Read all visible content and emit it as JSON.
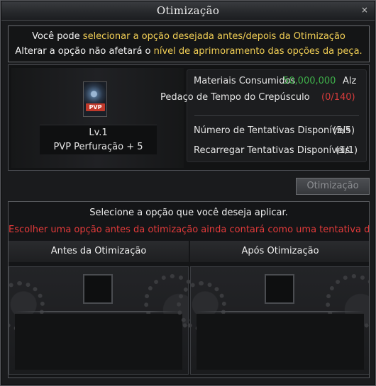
{
  "window": {
    "title": "Otimização",
    "close_label": "×"
  },
  "info": {
    "line1_a": "Você pode ",
    "line1_b": "selecionar a opção desejada antes/depois da Otimização",
    "line2_a": "Alterar a opção não afetará o ",
    "line2_b": "nível de aprimoramento das opções da peça."
  },
  "item": {
    "badge": "PVP",
    "level": "Lv.1",
    "name": "PVP Perfuração  + 5"
  },
  "stats": {
    "materials_label": "Materiais Consumidos",
    "materials_value": "50,000,000",
    "materials_unit": "Alz",
    "piece_label": "Pedaço de Tempo do Crepúsculo",
    "piece_value": "(0/140)",
    "attempts_label": "Número de Tentativas Disponíveis",
    "attempts_value": "(5/5)",
    "reload_label": "Recarregar Tentativas Disponíveis",
    "reload_value": "(1/1)"
  },
  "optimize_button": "Otimização",
  "select": {
    "title": "Selecione a opção que você deseja aplicar.",
    "warning": "Escolher uma opção antes da otimização ainda contará como uma tentativa de otimização.",
    "before_label": "Antes da Otimização",
    "after_label": "Após Otimização"
  },
  "colors": {
    "highlight": "#f2cf55",
    "green": "#3fb04a",
    "red": "#d53b3b",
    "warning": "#e23a3a"
  }
}
